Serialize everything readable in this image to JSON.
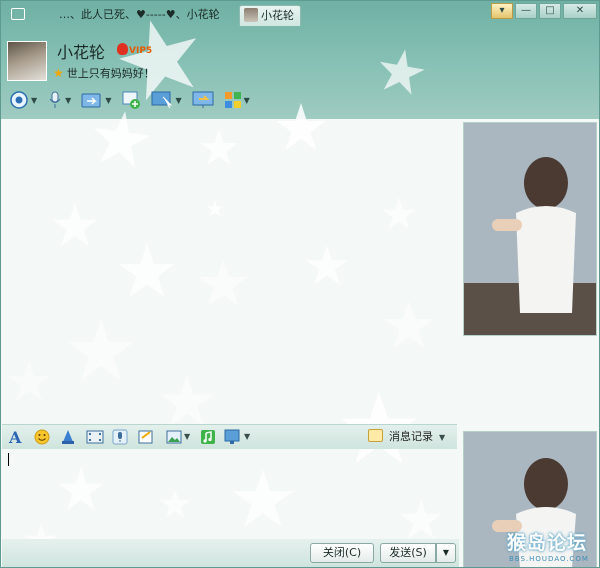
{
  "tabs": [
    {
      "label": "…、此人已死、♥-----♥、小花轮",
      "active": false
    },
    {
      "label": "小花轮",
      "active": true
    }
  ],
  "window_controls": {
    "menu": "▾",
    "minimize": "—",
    "maximize": "□",
    "close": "✕"
  },
  "contact": {
    "name": "小花轮",
    "badge": "VIP5",
    "signature": "世上只有妈妈好！"
  },
  "top_toolbar_icons": [
    "video-call-icon",
    "voice-call-icon",
    "send-file-icon",
    "share-screen-icon",
    "remote-desktop-icon",
    "screen-share-icon",
    "apps-icon"
  ],
  "input_toolbar_icons": [
    "font-icon",
    "emoji-icon",
    "magic-icon",
    "video-clip-icon",
    "voice-message-icon",
    "screenshot-icon",
    "image-icon",
    "music-icon",
    "screen-capture-icon"
  ],
  "history": {
    "label": "消息记录"
  },
  "buttons": {
    "close": "关闭(C)",
    "send": "发送(S)",
    "send_dropdown": "▼"
  },
  "watermark": {
    "main": "猴岛论坛",
    "sub": "BBS.HOUDAO.COM"
  },
  "colors": {
    "accent": "#6fb1a4",
    "panel": "#f4f8f7",
    "vip": "#e55c00"
  }
}
